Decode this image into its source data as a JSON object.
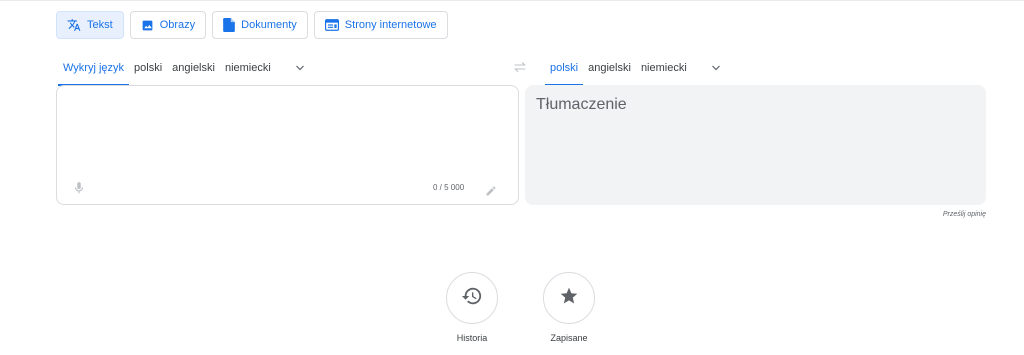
{
  "modes": [
    {
      "label": "Tekst",
      "icon": "translate-icon",
      "active": true
    },
    {
      "label": "Obrazy",
      "icon": "image-icon",
      "active": false
    },
    {
      "label": "Dokumenty",
      "icon": "document-icon",
      "active": false
    },
    {
      "label": "Strony internetowe",
      "icon": "web-icon",
      "active": false
    }
  ],
  "source_langs": {
    "tabs": [
      "Wykryj język",
      "polski",
      "angielski",
      "niemiecki"
    ],
    "active_index": 0
  },
  "target_langs": {
    "tabs": [
      "polski",
      "angielski",
      "niemiecki"
    ],
    "active_index": 0
  },
  "source_panel": {
    "counter": "0 / 5 000"
  },
  "target_panel": {
    "placeholder": "Tłumaczenie"
  },
  "feedback_label": "Prześlij opinię",
  "bottom": {
    "history_label": "Historia",
    "saved_label": "Zapisane"
  },
  "colors": {
    "accent": "#1a73e8",
    "panel_bg": "#f1f3f4",
    "border": "#dadce0"
  }
}
